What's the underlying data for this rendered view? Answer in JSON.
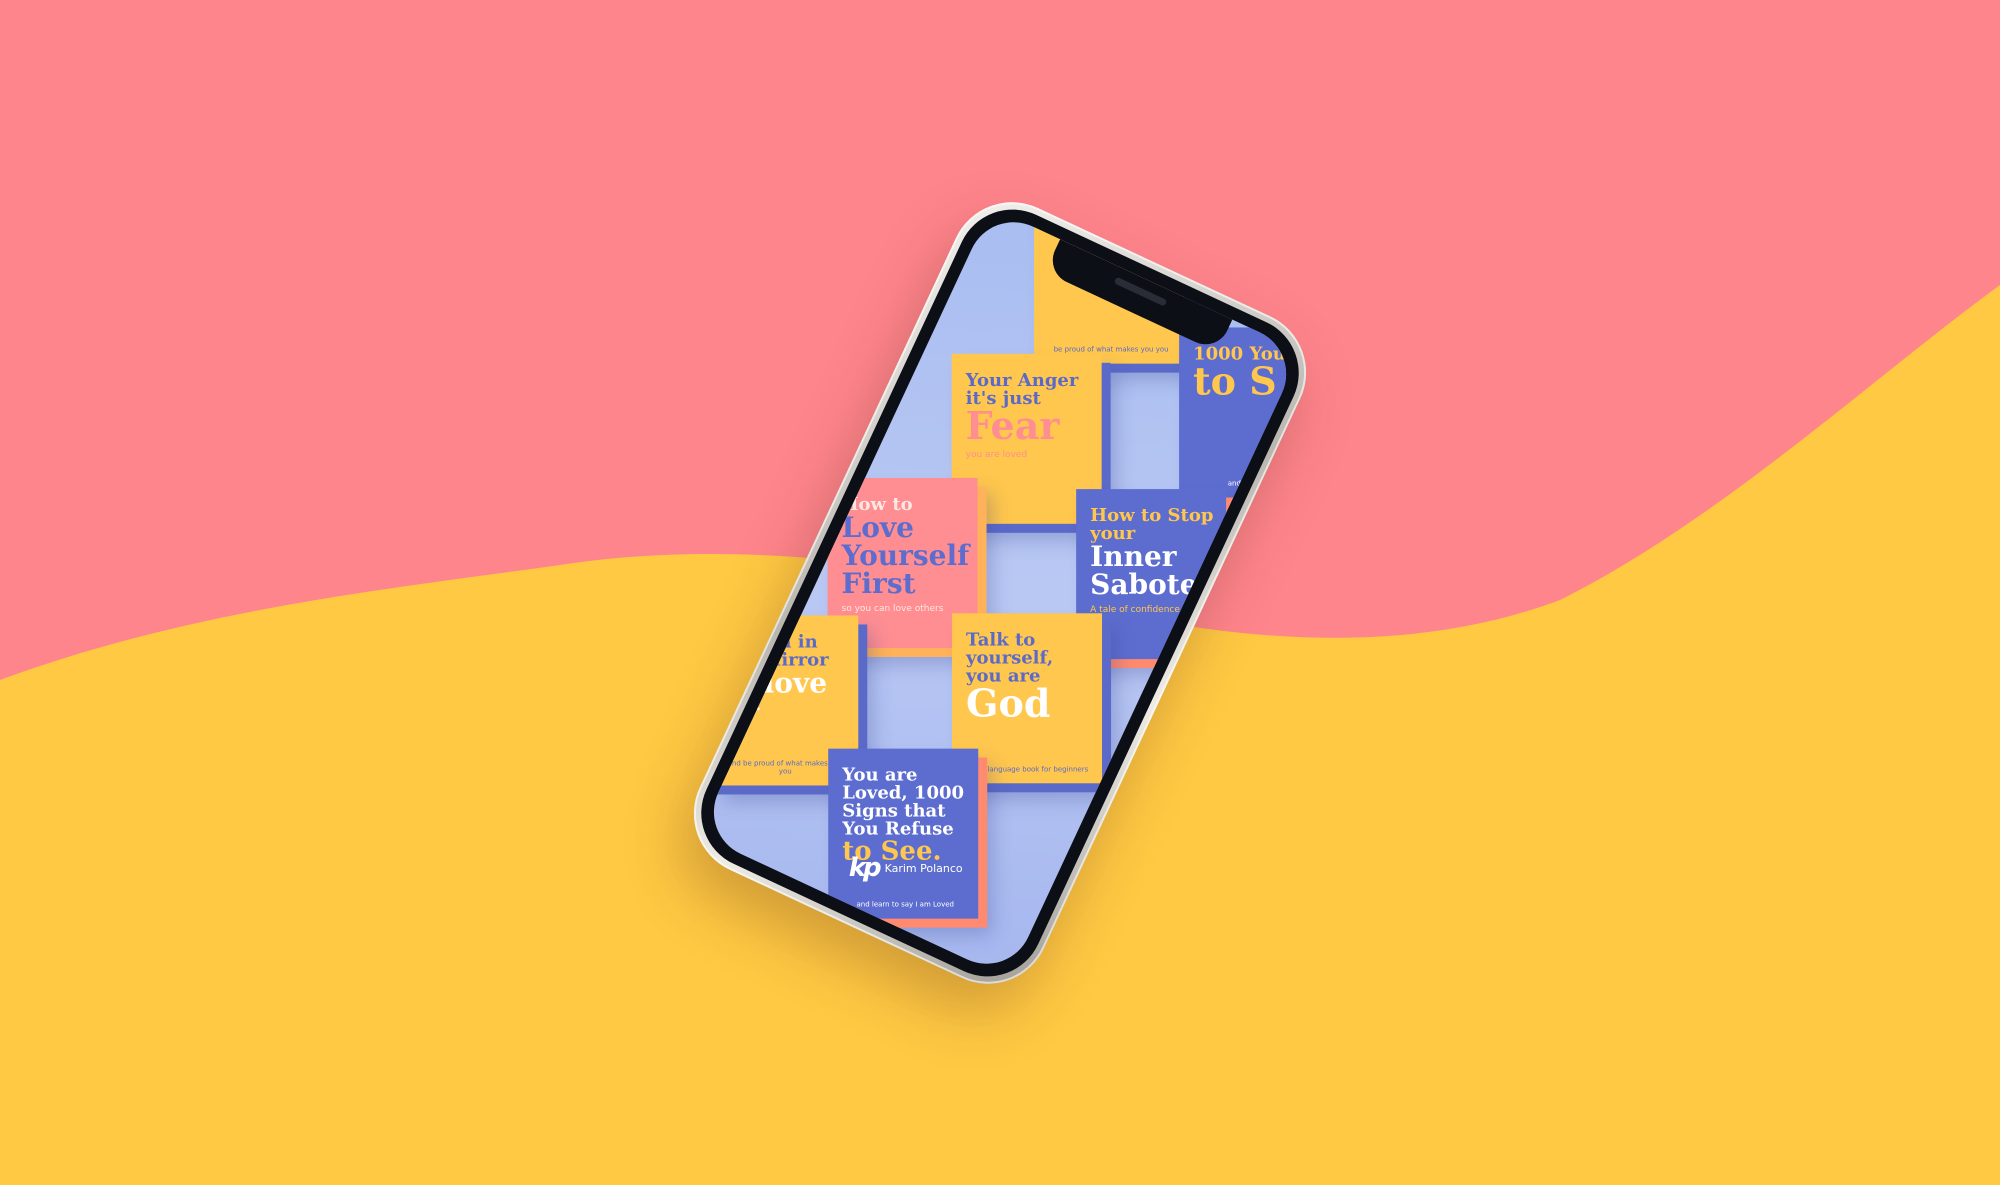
{
  "colors": {
    "background_pink": "#ff858c",
    "background_yellow": "#ffc943",
    "screen_blue": "#a9bdf1",
    "book_yellow": "#ffc74d",
    "book_pink": "#ff8e92",
    "book_blue": "#5d6dcf"
  },
  "phone": {
    "screen": {
      "books": [
        {
          "id": "anger",
          "line1": "Your Anger it's just",
          "line2": "Fear",
          "subtitle": "you are loved",
          "footer": ""
        },
        {
          "id": "saboteur",
          "line1": "How to Stop your",
          "line2": "Inner Saboteur",
          "subtitle": "A tale of confidence",
          "footer": ""
        },
        {
          "id": "love",
          "line1": "How to",
          "line2": "Love Yourself First",
          "subtitle": "so you can love others",
          "footer": ""
        },
        {
          "id": "god",
          "line1": "Talk to yourself, you are",
          "line2": "God",
          "subtitle": "",
          "footer": "Kind language book for beginners"
        },
        {
          "id": "mirror",
          "line1": "Person in the Mirror",
          "line2": "to love B*",
          "subtitle": "",
          "footer": "and be proud of what makes you you"
        },
        {
          "id": "loved",
          "line1": "You are Loved, 1000 Signs that You Refuse",
          "line2": "to See.",
          "subtitle": "",
          "footer": "and learn to say I am Loved"
        },
        {
          "id": "top-right",
          "line1": "1000 You",
          "line2": "to S",
          "subtitle": "",
          "footer": "and learn to say"
        },
        {
          "id": "top",
          "line1": "",
          "line2": "",
          "subtitle": "",
          "footer": "be proud of what makes you you"
        }
      ],
      "logo": {
        "mark": "kp",
        "name": "Karim Polanco"
      }
    }
  }
}
